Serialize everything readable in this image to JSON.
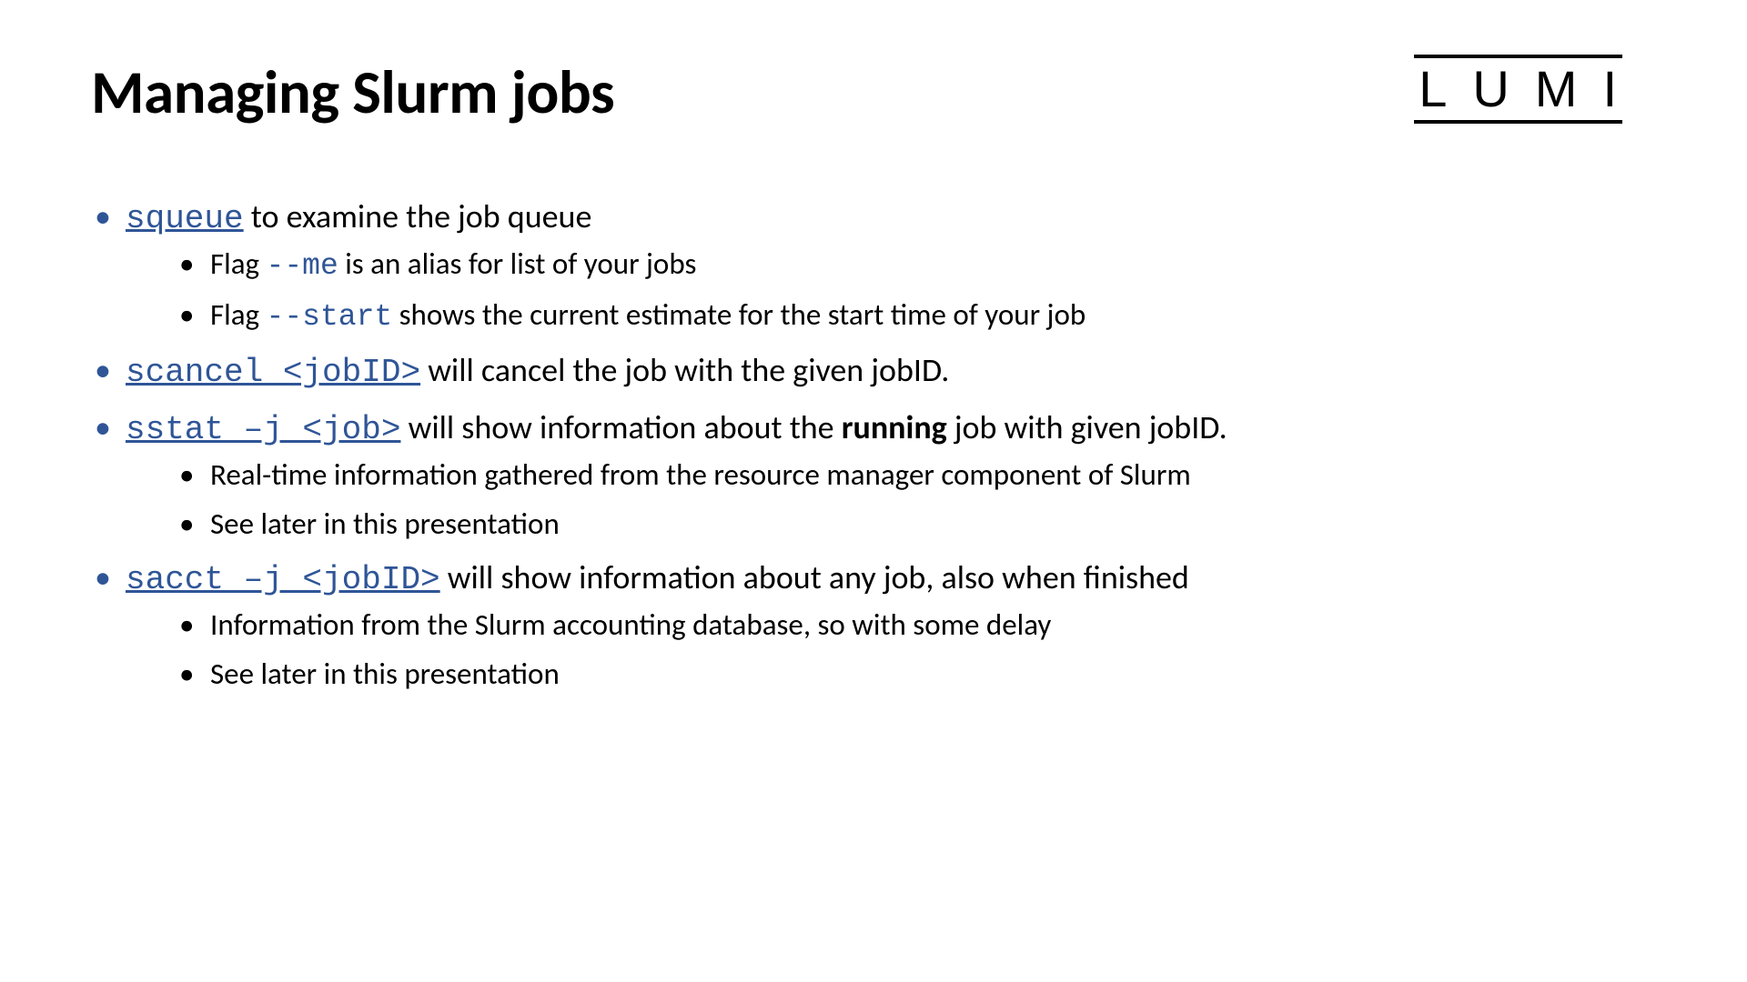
{
  "title": "Managing Slurm jobs",
  "logo": "LUMI",
  "b1": {
    "cmd": "squeue",
    "text": " to examine the job queue",
    "sub1_pre": "Flag ",
    "sub1_code": "--me",
    "sub1_post": " is an alias for list of your jobs",
    "sub2_pre": "Flag ",
    "sub2_code": "--start",
    "sub2_post": " shows  the current estimate for the start time of your job"
  },
  "b2": {
    "cmd": "scancel <jobID>",
    "text": " will cancel the job with the given jobID."
  },
  "b3": {
    "cmd": "sstat –j <job>",
    "text_pre": " will show information about the ",
    "text_bold": "running",
    "text_post": " job with given jobID.",
    "sub1": "Real-time information gathered from the resource manager component of Slurm",
    "sub2": "See later in this presentation"
  },
  "b4": {
    "cmd": "sacct –j <jobID>",
    "text": " will show information about any job, also when finished",
    "sub1": "Information from the Slurm accounting database, so with some delay",
    "sub2": "See later in this presentation"
  }
}
